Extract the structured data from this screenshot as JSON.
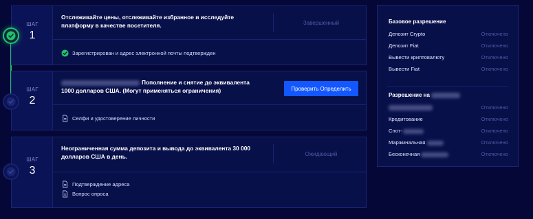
{
  "steps": [
    {
      "label": "ШАГ",
      "number": "1",
      "description": "Отслеживайте цены, отслеживайте избранное и исследуйте платформу в качестве посетителя.",
      "status": "Завершенный",
      "requirements": [
        "Зарегистрирован и адрес электронной почты подтвержден"
      ]
    },
    {
      "label": "ШАГ",
      "number": "2",
      "description": "Пополнение и снятие до эквивалента 1000 долларов США. (Могут применяться ограничения)",
      "action_label": "Проверить Определить",
      "requirements": [
        "Селфи и удостоверение личности"
      ]
    },
    {
      "label": "ШАГ",
      "number": "3",
      "description": "Неограниченная сумма депозита и вывода до эквивалента 30 000 долларов США в день.",
      "status": "Ожидающий",
      "requirements": [
        "Подтверждение адреса",
        "Вопрос опроса"
      ]
    }
  ],
  "permissions": {
    "basic": {
      "title": "Базовое разрешение",
      "rows": [
        {
          "label": "Депозит Crypto",
          "value": "Отключено"
        },
        {
          "label": "Депозит Fiat",
          "value": "Отключено"
        },
        {
          "label": "Вывести криптовалюту",
          "value": "Отключено"
        },
        {
          "label": "Вывести Fiat",
          "value": "Отключено"
        }
      ]
    },
    "extended": {
      "title": "Разрешение на",
      "rows": [
        {
          "label": "",
          "value": "Отключено"
        },
        {
          "label": "Кредитование",
          "value": "Отключено"
        },
        {
          "label": "Спот-",
          "value": "Отключено"
        },
        {
          "label": "Маржинальная",
          "value": "Отключено"
        },
        {
          "label": "Бесконечная",
          "value": "Отключено"
        }
      ]
    }
  },
  "colors": {
    "background": "#050836",
    "card": "#08104a",
    "accent_blue": "#1257ff",
    "success_green": "#22c06a",
    "muted_status": "#4f5aa3"
  }
}
